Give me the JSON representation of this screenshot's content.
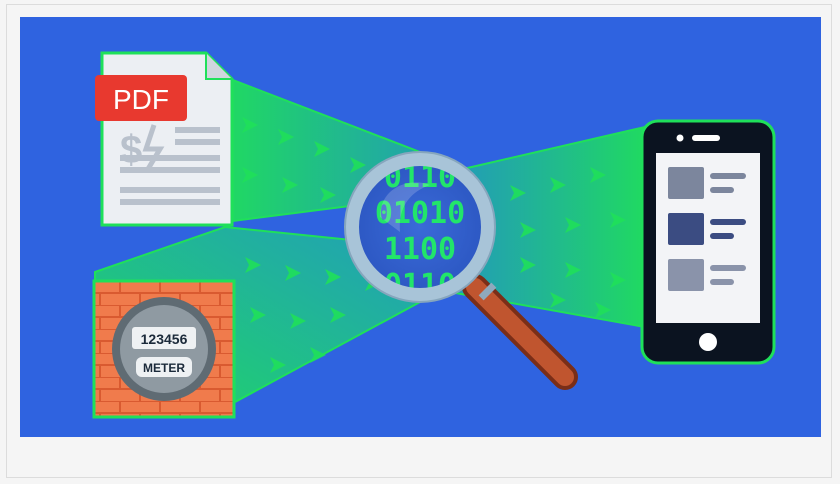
{
  "illustration": {
    "pdf_badge": "PDF",
    "currency_glyph": "$",
    "meter_reading": "123456",
    "meter_label": "METER",
    "binary_lines": [
      "0110",
      "01010",
      "1100",
      "0110"
    ]
  },
  "colors": {
    "background": "#2f63e0",
    "beam": "#1fe05a",
    "pdf_badge": "#e8392f",
    "magnifier_ring": "#a8c4d8",
    "handle": "#b64a2a",
    "brick": "#f07b4c",
    "phone_body": "#0b1320",
    "binary_digits": "#22e56a"
  }
}
